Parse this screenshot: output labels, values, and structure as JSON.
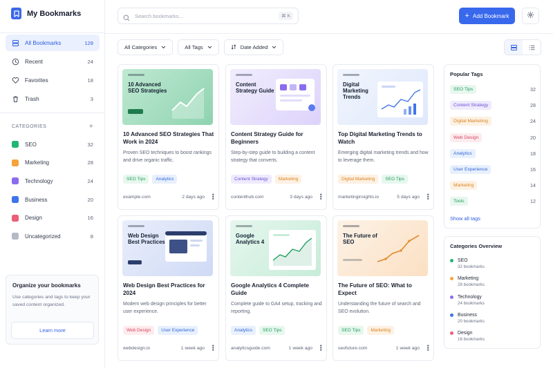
{
  "app": {
    "title": "My Bookmarks"
  },
  "nav": [
    {
      "label": "All Bookmarks",
      "count": "128",
      "icon": "layers-icon",
      "active": true
    },
    {
      "label": "Recent",
      "count": "24",
      "icon": "clock-icon"
    },
    {
      "label": "Favorites",
      "count": "18",
      "icon": "heart-icon"
    },
    {
      "label": "Trash",
      "count": "3",
      "icon": "trash-icon"
    }
  ],
  "categories_header": "CATEGORIES",
  "categories": [
    {
      "label": "SEO",
      "count": "32",
      "color": "#22b573"
    },
    {
      "label": "Marketing",
      "count": "28",
      "color": "#f5a33b"
    },
    {
      "label": "Technology",
      "count": "24",
      "color": "#8b6cf0"
    },
    {
      "label": "Business",
      "count": "20",
      "color": "#3f74ea"
    },
    {
      "label": "Design",
      "count": "16",
      "color": "#ec5f78"
    },
    {
      "label": "Uncategorized",
      "count": "8",
      "color": "#b5bac6"
    }
  ],
  "promo": {
    "title": "Organize your bookmarks",
    "text": "Use categories and tags to keep your saved content organized.",
    "button": "Learn more"
  },
  "search": {
    "placeholder": "Search bookmarks...",
    "shortcut": "⌘ K"
  },
  "add_button": "Add Bookmark",
  "filters": {
    "category": "All Categories",
    "tags": "All Tags",
    "sort": "Date Added"
  },
  "cards": [
    {
      "thumb_title": "10 Advanced SEO Strategies",
      "title": "10 Advanced SEO Strategies That Work in 2024",
      "desc": "Proven SEO techniques to boost rankings and drive organic traffic.",
      "tags": [
        "SEO Tips",
        "Analytics"
      ],
      "domain": "example.com",
      "time": "2 days ago"
    },
    {
      "thumb_title": "Content Strategy Guide",
      "title": "Content Strategy Guide for Beginners",
      "desc": "Step-by-step guide to building a content strategy that converts.",
      "tags": [
        "Content Strategy",
        "Marketing"
      ],
      "domain": "contenthub.com",
      "time": "3 days ago"
    },
    {
      "thumb_title": "Digital Marketing Trends",
      "title": "Top Digital Marketing Trends to Watch",
      "desc": "Emerging digital marketing trends and how to leverage them.",
      "tags": [
        "Digital Marketing",
        "SEO Tips"
      ],
      "domain": "marketinginsights.io",
      "time": "5 days ago"
    },
    {
      "thumb_title": "Web Design Best Practices",
      "title": "Web Design Best Practices for 2024",
      "desc": "Modern web design principles for better user experience.",
      "tags": [
        "Web Design",
        "User Experience"
      ],
      "domain": "webdesign.io",
      "time": "1 week ago"
    },
    {
      "thumb_title": "Google Analytics 4",
      "title": "Google Analytics 4 Complete Guide",
      "desc": "Complete guide to GA4 setup, tracking and reporting.",
      "tags": [
        "Analytics",
        "SEO Tips"
      ],
      "domain": "analyticsguide.com",
      "time": "1 week ago"
    },
    {
      "thumb_title": "The Future of SEO",
      "title": "The Future of SEO: What to Expect",
      "desc": "Understanding the future of search and SEO evolution.",
      "tags": [
        "SEO Tips",
        "Marketing"
      ],
      "domain": "seofuture.com",
      "time": "1 week ago"
    }
  ],
  "tag_colors": {
    "SEO Tips": {
      "bg": "#e7f7ee",
      "fg": "#1f9d5c"
    },
    "Analytics": {
      "bg": "#e8f0fd",
      "fg": "#3267d6"
    },
    "Content Strategy": {
      "bg": "#efebfd",
      "fg": "#6a4fd4"
    },
    "Marketing": {
      "bg": "#fdf1e3",
      "fg": "#d9831d"
    },
    "Digital Marketing": {
      "bg": "#fdf1e3",
      "fg": "#d9831d"
    },
    "Web Design": {
      "bg": "#fdebee",
      "fg": "#d6455f"
    },
    "User Experience": {
      "bg": "#e8f0fd",
      "fg": "#3267d6"
    },
    "Tools": {
      "bg": "#e7f7ee",
      "fg": "#1f9d5c"
    }
  },
  "popular_tags": {
    "title": "Popular Tags",
    "items": [
      {
        "label": "SEO Tips",
        "count": "32"
      },
      {
        "label": "Content Strategy",
        "count": "28"
      },
      {
        "label": "Digital Marketing",
        "count": "24"
      },
      {
        "label": "Web Design",
        "count": "20"
      },
      {
        "label": "Analytics",
        "count": "18"
      },
      {
        "label": "User Experience",
        "count": "16"
      },
      {
        "label": "Marketing",
        "count": "14"
      },
      {
        "label": "Tools",
        "count": "12"
      }
    ],
    "show_all": "Show all tags"
  },
  "categories_overview": {
    "title": "Categories Overview",
    "items": [
      {
        "name": "SEO",
        "sub": "32 bookmarks",
        "color": "#22b573"
      },
      {
        "name": "Marketing",
        "sub": "28 bookmarks",
        "color": "#f5a33b"
      },
      {
        "name": "Technology",
        "sub": "24 bookmarks",
        "color": "#8b6cf0"
      },
      {
        "name": "Business",
        "sub": "20 bookmarks",
        "color": "#3f74ea"
      },
      {
        "name": "Design",
        "sub": "16 bookmarks",
        "color": "#ec5f78"
      }
    ]
  }
}
